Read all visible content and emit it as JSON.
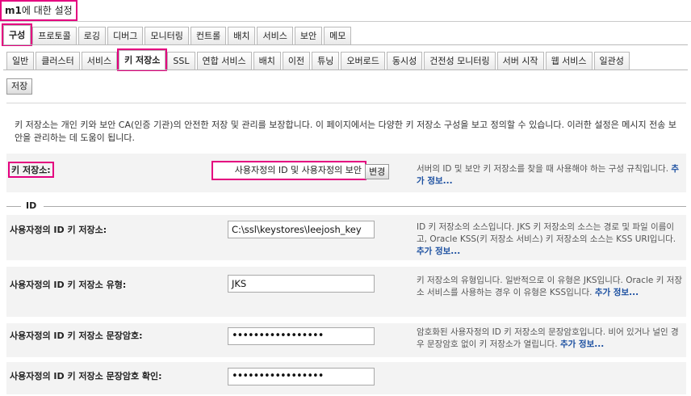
{
  "title": {
    "strong": "m1",
    "rest": "에 대한 설정"
  },
  "tabs_top": [
    "구성",
    "프로토콜",
    "로깅",
    "디버그",
    "모니터링",
    "컨트롤",
    "배치",
    "서비스",
    "보안",
    "메모"
  ],
  "tabs_sub": [
    "일반",
    "클러스터",
    "서비스",
    "키 저장소",
    "SSL",
    "연합 서비스",
    "배치",
    "이전",
    "튜닝",
    "오버로드",
    "동시성",
    "건전성 모니터링",
    "서버 시작",
    "웹 서비스",
    "일관성"
  ],
  "save_label": "저장",
  "description": "키 저장소는 개인 키와 보안 CA(인증 기관)의 안전한 저장 및 관리를 보장합니다. 이 페이지에서는 다양한 키 저장소 구성을 보고 정의할 수 있습니다. 이러한 설정은 메시지 전송 보안을 관리하는 데 도움이 됩니다.",
  "keystores": {
    "label": "키 저장소:",
    "value": "사용자정의 ID 및 사용자정의 보안",
    "change_label": "변경",
    "help": "서버의 ID 및 보안 키 저장소를 찾을 때 사용해야 하는 구성 규칙입니다.",
    "more": "추가 정보..."
  },
  "section_id": "ID",
  "fields": [
    {
      "label": "사용자정의 ID 키 저장소:",
      "value": "C:\\ssl\\keystores\\leejosh_key",
      "help": "ID 키 저장소의 소스입니다. JKS 키 저장소의 소스는 경로 및 파일 이름이고, Oracle KSS(키 저장소 서비스) 키 저장소의 소스는 KSS URI입니다.",
      "more": "추가 정보..."
    },
    {
      "label": "사용자정의 ID 키 저장소 유형:",
      "value": "JKS",
      "help": "키 저장소의 유형입니다. 일반적으로 이 유형은 JKS입니다. Oracle 키 저장소 서비스를 사용하는 경우 이 유형은 KSS입니다.",
      "more": "추가 정보..."
    },
    {
      "label": "사용자정의 ID 키 저장소 문장암호:",
      "value": "•••••••••••••••••",
      "help": "암호화된 사용자정의 ID 키 저장소의 문장암호입니다. 비어 있거나 널인 경우 문장암호 없이 키 저장소가 열립니다.",
      "more": "추가 정보..."
    },
    {
      "label": "사용자정의 ID 키 저장소 문장암호 확인:",
      "value": "•••••••••••••••••",
      "help": "",
      "more": ""
    }
  ]
}
